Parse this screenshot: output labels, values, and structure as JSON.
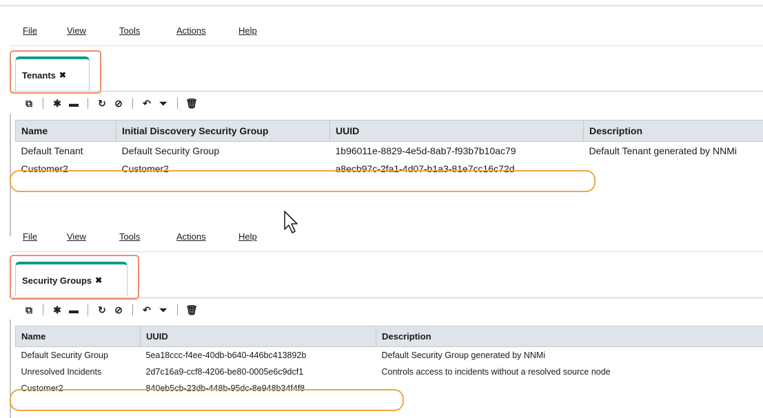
{
  "menu": [
    "File",
    "View",
    "Tools",
    "Actions",
    "Help"
  ],
  "toolbar_icons": [
    "open-icon",
    "new-icon",
    "folder-icon",
    "refresh-icon",
    "stop-refresh-icon",
    "undo-icon",
    "filter-icon",
    "delete-icon"
  ],
  "tenants": {
    "tab_label": "Tenants",
    "close_glyph": "✖",
    "columns": [
      "Name",
      "Initial Discovery Security Group",
      "UUID",
      "Description"
    ],
    "rows": [
      [
        "Default Tenant",
        "Default Security Group",
        "1b96011e-8829-4e5d-8ab7-f93b7b10ac79",
        "Default Tenant generated by NNMi"
      ],
      [
        "Customer2",
        "Customer2",
        "a8ecb97c-2fa1-4d07-b1a3-81e7cc16c72d",
        ""
      ]
    ]
  },
  "security_groups": {
    "tab_label": "Security Groups",
    "close_glyph": "✖",
    "columns": [
      "Name",
      "UUID",
      "Description"
    ],
    "rows": [
      [
        "Default Security Group",
        "5ea18ccc-f4ee-40db-b640-446bc413892b",
        "Default Security Group generated by NNMi"
      ],
      [
        "Unresolved Incidents",
        "2d7c16a9-ccf8-4206-be80-0005e6c9dcf1",
        "Controls access to incidents without a resolved source node"
      ],
      [
        "Customer2",
        "840eb5cb-23db-448b-95dc-8e948b34f4f8",
        ""
      ]
    ]
  },
  "colors": {
    "tab_accent": "#0e9c84",
    "callout_rect": "#ee8a6c",
    "callout_oval": "#f0a445",
    "header_bg": "#dfe4ea"
  }
}
